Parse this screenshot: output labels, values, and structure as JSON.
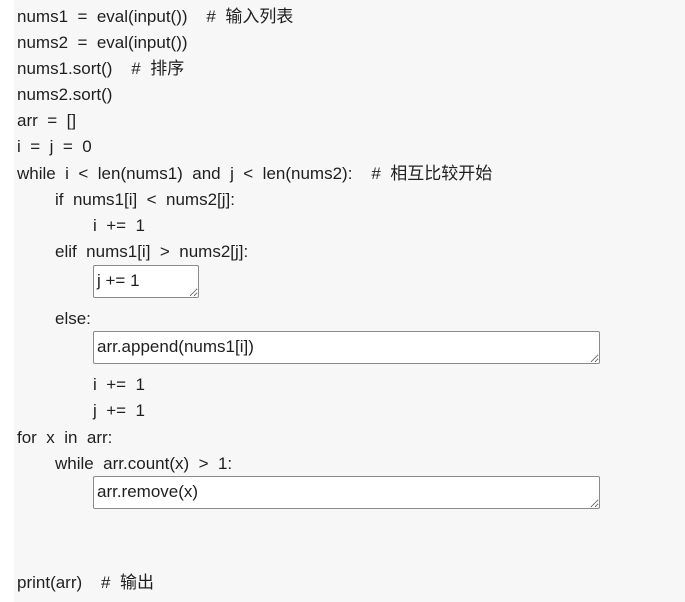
{
  "code": {
    "line1": "nums1  =  eval(input())    #  输入列表",
    "line2": "nums2  =  eval(input())",
    "line3": "nums1.sort()    #  排序",
    "line4": "nums2.sort()",
    "line5": "arr  =  []",
    "line6": "i  =  j  =  0",
    "line7": "while  i  <  len(nums1)  and  j  <  len(nums2):    #  相互比较开始",
    "line8": "if  nums1[i]  <  nums2[j]:",
    "line9": "i  +=  1",
    "line10": "elif  nums1[i]  >  nums2[j]:",
    "line12": "else:",
    "line14": "i  +=  1",
    "line15": "j  +=  1",
    "line16": "for  x  in  arr:",
    "line17": "while  arr.count(x)  >  1:",
    "line19": "print(arr)    #  输出"
  },
  "blanks": {
    "blank1": "j += 1",
    "blank2": "arr.append(nums1[i])",
    "blank3": "arr.remove(x)"
  }
}
